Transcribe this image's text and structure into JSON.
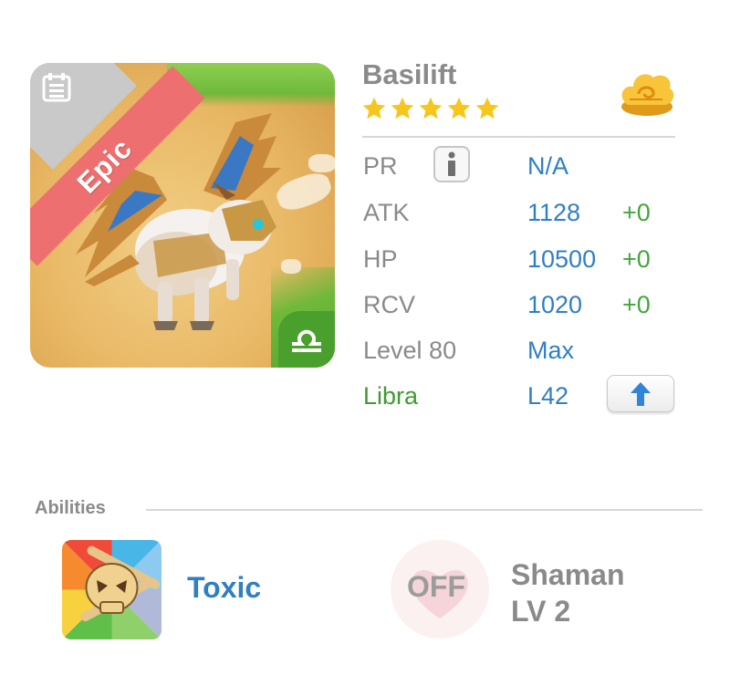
{
  "monster": {
    "name": "Basilift",
    "rarity": "Epic",
    "stars": 5,
    "element_icon": "cloud-wind-icon",
    "zodiac_icon": "libra-icon"
  },
  "stats": {
    "pr": {
      "label": "PR",
      "value": "N/A"
    },
    "atk": {
      "label": "ATK",
      "value": "1128",
      "bonus": "+0"
    },
    "hp": {
      "label": "HP",
      "value": "10500",
      "bonus": "+0"
    },
    "rcv": {
      "label": "RCV",
      "value": "1020",
      "bonus": "+0"
    },
    "level": {
      "label": "Level 80",
      "value": "Max"
    },
    "zodiac": {
      "label": "Libra",
      "value": "L42"
    }
  },
  "abilities": {
    "section_label": "Abilities",
    "ability": {
      "name": "Toxic",
      "icon": "skull-crossbones-icon"
    },
    "skill": {
      "status": "OFF",
      "name_line1": "Shaman",
      "name_line2": "LV 2"
    }
  },
  "colors": {
    "label_gray": "#8a8a8a",
    "value_blue": "#2f7fc4",
    "bonus_green": "#43a53b",
    "zodiac_green": "#3d9b32",
    "ribbon_red": "#ee6f6f",
    "star_yellow": "#f6c61c"
  }
}
